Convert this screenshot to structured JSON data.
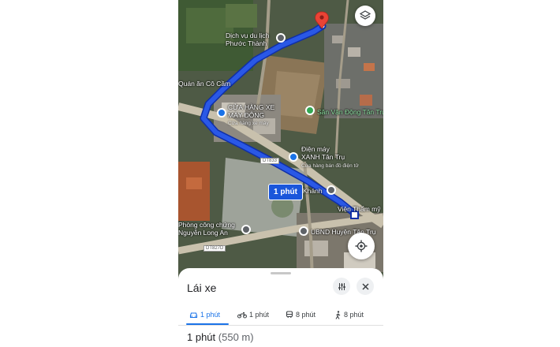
{
  "map": {
    "labels": {
      "dich_vu": "Dịch vụ du lịch\nPhước Thành",
      "quan_an": "Quán ăn Cô Cầm",
      "cua_hang": "CỬA HÀNG XE\nMÁY ĐÔNG",
      "cua_hang_sub": "Cửa hàng xe máy",
      "san_van_dong": "Sân Vận Động Tân Trụ",
      "dien_may": "Điện máy\nXANH Tân Trụ",
      "dien_may_sub": "Cửa hàng bán đồ điện tử",
      "khanh": "Khánh",
      "vien_tham_my": "Viện Thẩm mỹ",
      "phong_cong_chung": "Phòng công chứng\nNguyễn Long An",
      "ubnd": "UBND Huyện Tân Trụ"
    },
    "road_tags": [
      "DT833",
      "DT827D"
    ],
    "route_time": "1 phút",
    "colors": {
      "route": "#2a58e6",
      "pin": "#ea4335",
      "accent": "#1a73e8"
    },
    "icons": [
      "layers-icon",
      "my-location-icon",
      "destination-pin-icon"
    ]
  },
  "sheet": {
    "title": "Lái xe",
    "tabs": [
      {
        "mode": "car",
        "label": "1 phút"
      },
      {
        "mode": "motorbike",
        "label": "1 phút"
      },
      {
        "mode": "transit",
        "label": "8 phút"
      },
      {
        "mode": "walk",
        "label": "8 phút"
      }
    ],
    "summary_time": "1 phút",
    "summary_distance": "(550 m)"
  }
}
